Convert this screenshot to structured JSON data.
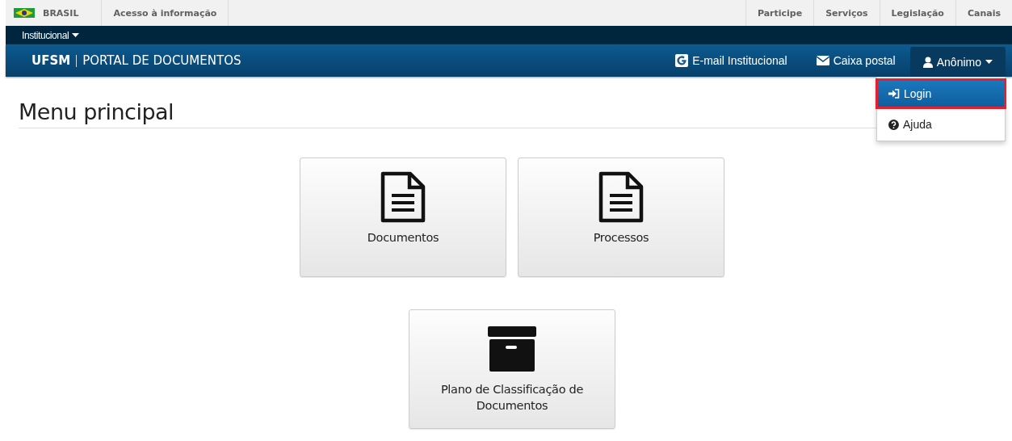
{
  "gov_bar": {
    "country": "BRASIL",
    "left_links": [
      "Acesso à informação"
    ],
    "right_links": [
      "Participe",
      "Serviços",
      "Legislação",
      "Canais"
    ]
  },
  "top_menu": {
    "label": "Institucional"
  },
  "header": {
    "brand": "UFSM",
    "title": "PORTAL DE DOCUMENTOS",
    "links": [
      {
        "kind": "google",
        "label": "E-mail Institucional"
      },
      {
        "kind": "mail",
        "label": "Caixa postal"
      }
    ],
    "user_menu": {
      "label": "Anônimo",
      "expanded": true,
      "items": [
        {
          "kind": "login",
          "label": "Login",
          "selected": true,
          "highlighted": true
        },
        {
          "kind": "help",
          "label": "Ajuda",
          "selected": false,
          "highlighted": false
        }
      ]
    }
  },
  "page_title": "Menu principal",
  "tiles": [
    {
      "kind": "document",
      "label": "Documentos"
    },
    {
      "kind": "document",
      "label": "Processos"
    },
    {
      "kind": "archive",
      "label": "Plano de Classificação de Documentos"
    }
  ]
}
